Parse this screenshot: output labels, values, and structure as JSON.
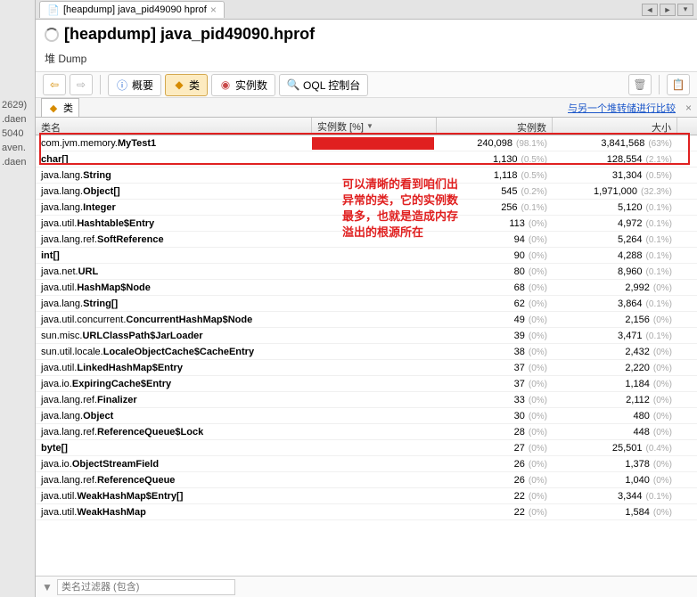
{
  "outer": {
    "items": [
      "2629)",
      ".daen",
      "5040",
      "aven.",
      ".daen"
    ]
  },
  "tab": {
    "label": "[heapdump] java_pid49090 hprof"
  },
  "title": "[heapdump] java_pid49090.hprof",
  "subtitle": "堆 Dump",
  "toolbar": {
    "overview": "概要",
    "classes": "类",
    "instances": "实例数",
    "oql": "OQL 控制台"
  },
  "sub_tab": {
    "label": "类"
  },
  "compare_link": "与另一个堆转储进行比较",
  "columns": {
    "name": "类名",
    "pct": "实例数 [%]",
    "inst": "实例数",
    "size": "大小"
  },
  "rows": [
    {
      "pkg": "com.jvm.memory.",
      "cls": "MyTest1",
      "bar": 98.1,
      "inst": "240,098",
      "ipct": "(98.1%)",
      "size": "3,841,568",
      "spct": "(63%)"
    },
    {
      "pkg": "",
      "cls": "char[]",
      "bar": 0,
      "inst": "1,130",
      "ipct": "(0.5%)",
      "size": "128,554",
      "spct": "(2.1%)"
    },
    {
      "pkg": "java.lang.",
      "cls": "String",
      "bar": 0,
      "inst": "1,118",
      "ipct": "(0.5%)",
      "size": "31,304",
      "spct": "(0.5%)"
    },
    {
      "pkg": "java.lang.",
      "cls": "Object[]",
      "bar": 0,
      "inst": "545",
      "ipct": "(0.2%)",
      "size": "1,971,000",
      "spct": "(32.3%)"
    },
    {
      "pkg": "java.lang.",
      "cls": "Integer",
      "bar": 0,
      "inst": "256",
      "ipct": "(0.1%)",
      "size": "5,120",
      "spct": "(0.1%)"
    },
    {
      "pkg": "java.util.",
      "cls": "Hashtable$Entry",
      "bar": 0,
      "inst": "113",
      "ipct": "(0%)",
      "size": "4,972",
      "spct": "(0.1%)"
    },
    {
      "pkg": "java.lang.ref.",
      "cls": "SoftReference",
      "bar": 0,
      "inst": "94",
      "ipct": "(0%)",
      "size": "5,264",
      "spct": "(0.1%)"
    },
    {
      "pkg": "",
      "cls": "int[]",
      "bar": 0,
      "inst": "90",
      "ipct": "(0%)",
      "size": "4,288",
      "spct": "(0.1%)"
    },
    {
      "pkg": "java.net.",
      "cls": "URL",
      "bar": 0,
      "inst": "80",
      "ipct": "(0%)",
      "size": "8,960",
      "spct": "(0.1%)"
    },
    {
      "pkg": "java.util.",
      "cls": "HashMap$Node",
      "bar": 0,
      "inst": "68",
      "ipct": "(0%)",
      "size": "2,992",
      "spct": "(0%)"
    },
    {
      "pkg": "java.lang.",
      "cls": "String[]",
      "bar": 0,
      "inst": "62",
      "ipct": "(0%)",
      "size": "3,864",
      "spct": "(0.1%)"
    },
    {
      "pkg": "java.util.concurrent.",
      "cls": "ConcurrentHashMap$Node",
      "bar": 0,
      "inst": "49",
      "ipct": "(0%)",
      "size": "2,156",
      "spct": "(0%)"
    },
    {
      "pkg": "sun.misc.",
      "cls": "URLClassPath$JarLoader",
      "bar": 0,
      "inst": "39",
      "ipct": "(0%)",
      "size": "3,471",
      "spct": "(0.1%)"
    },
    {
      "pkg": "sun.util.locale.",
      "cls": "LocaleObjectCache$CacheEntry",
      "bar": 0,
      "inst": "38",
      "ipct": "(0%)",
      "size": "2,432",
      "spct": "(0%)"
    },
    {
      "pkg": "java.util.",
      "cls": "LinkedHashMap$Entry",
      "bar": 0,
      "inst": "37",
      "ipct": "(0%)",
      "size": "2,220",
      "spct": "(0%)"
    },
    {
      "pkg": "java.io.",
      "cls": "ExpiringCache$Entry",
      "bar": 0,
      "inst": "37",
      "ipct": "(0%)",
      "size": "1,184",
      "spct": "(0%)"
    },
    {
      "pkg": "java.lang.ref.",
      "cls": "Finalizer",
      "bar": 0,
      "inst": "33",
      "ipct": "(0%)",
      "size": "2,112",
      "spct": "(0%)"
    },
    {
      "pkg": "java.lang.",
      "cls": "Object",
      "bar": 0,
      "inst": "30",
      "ipct": "(0%)",
      "size": "480",
      "spct": "(0%)"
    },
    {
      "pkg": "java.lang.ref.",
      "cls": "ReferenceQueue$Lock",
      "bar": 0,
      "inst": "28",
      "ipct": "(0%)",
      "size": "448",
      "spct": "(0%)"
    },
    {
      "pkg": "",
      "cls": "byte[]",
      "bar": 0,
      "inst": "27",
      "ipct": "(0%)",
      "size": "25,501",
      "spct": "(0.4%)"
    },
    {
      "pkg": "java.io.",
      "cls": "ObjectStreamField",
      "bar": 0,
      "inst": "26",
      "ipct": "(0%)",
      "size": "1,378",
      "spct": "(0%)"
    },
    {
      "pkg": "java.lang.ref.",
      "cls": "ReferenceQueue",
      "bar": 0,
      "inst": "26",
      "ipct": "(0%)",
      "size": "1,040",
      "spct": "(0%)"
    },
    {
      "pkg": "java.util.",
      "cls": "WeakHashMap$Entry[]",
      "bar": 0,
      "inst": "22",
      "ipct": "(0%)",
      "size": "3,344",
      "spct": "(0.1%)"
    },
    {
      "pkg": "java.util.",
      "cls": "WeakHashMap",
      "bar": 0,
      "inst": "22",
      "ipct": "(0%)",
      "size": "1,584",
      "spct": "(0%)"
    }
  ],
  "annotation": "可以清晰的看到咱们出\n异常的类，它的实例数\n最多，也就是造成内存\n溢出的根源所在",
  "filter": {
    "placeholder": "类名过滤器 (包含)"
  }
}
